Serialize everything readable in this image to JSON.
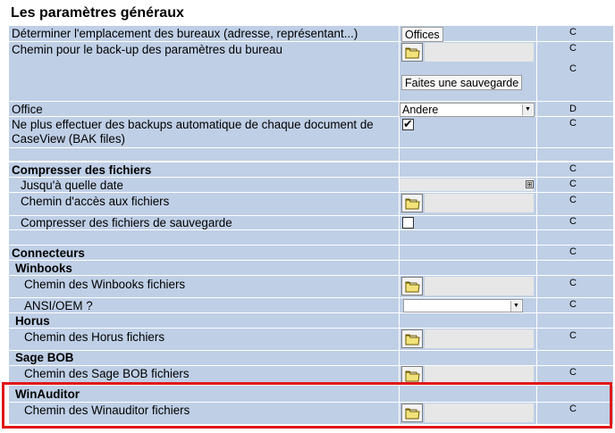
{
  "page_title": "Les paramètres généraux",
  "rows": {
    "location": "Déterminer l'emplacement des bureaux (adresse, représentant...)",
    "backup_path": "Chemin pour le back-up des paramètres du bureau",
    "office": "Office",
    "no_backups": "Ne plus effectuer des backups automatique de chaque document de",
    "no_backups_2": "CaseView (BAK files)",
    "compress_title": "Compresser des fichiers",
    "until_date": "Jusqu'à quelle date",
    "access_path": "Chemin d'accès aux fichiers",
    "compress_backups": "Compresser des fichiers de sauvegarde",
    "connectors": "Connecteurs",
    "winbooks": "Winbooks",
    "winbooks_path": "Chemin des Winbooks fichiers",
    "ansi_oem": "ANSI/OEM ?",
    "horus": "Horus",
    "horus_path": "Chemin des Horus fichiers",
    "sage_bob": "Sage BOB",
    "sage_path": "Chemin des Sage BOB fichiers",
    "winauditor": "WinAuditor",
    "winauditor_path": "Chemin des Winauditor fichiers"
  },
  "controls": {
    "offices_button": "Offices",
    "backup_button": "Faites une sauvegarde",
    "office_select_value": "Andere",
    "ansi_select_value": "",
    "no_backups_checked": true,
    "compress_backups_checked": false
  },
  "codes": {
    "c": "C",
    "d": "D"
  }
}
